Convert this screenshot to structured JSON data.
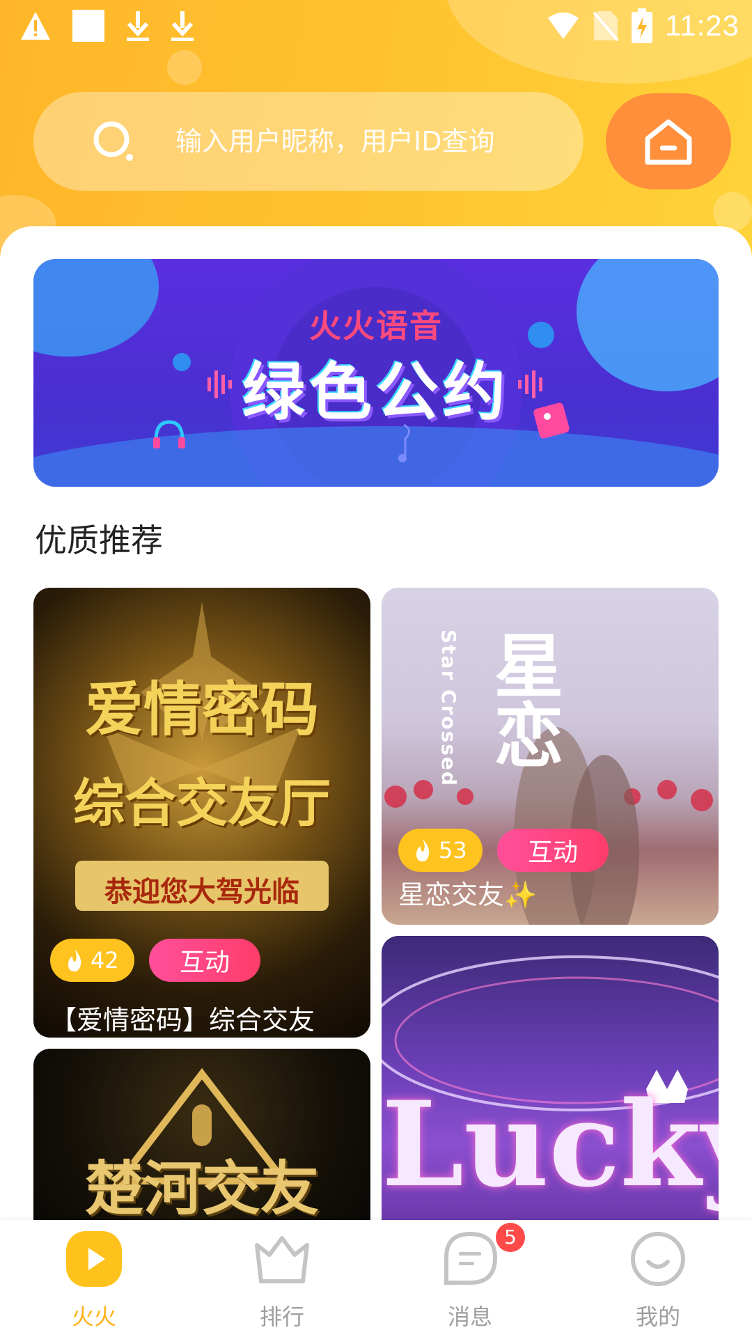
{
  "status_bar": {
    "time": "11:23"
  },
  "search": {
    "placeholder": "输入用户昵称，用户ID查询"
  },
  "banner": {
    "title_small": "火火语音",
    "title_big": "绿色公约"
  },
  "section": {
    "title": "优质推荐"
  },
  "rooms": [
    {
      "art_line1": "爱情密码",
      "art_line2": "综合交友厅",
      "art_line3": "恭迎您大驾光临",
      "heat": "42",
      "tag": "互动",
      "name": "【爱情密码】综合交友"
    },
    {
      "art_line1": "星恋",
      "art_subtitle": "Star Crossed",
      "heat": "53",
      "tag": "互动",
      "name": "星恋交友✨"
    },
    {
      "art_line1": "楚河交友"
    },
    {
      "art_line1": "Lucky"
    }
  ],
  "nav": {
    "items": [
      {
        "label": "火火",
        "icon": "play-icon"
      },
      {
        "label": "排行",
        "icon": "crown-icon"
      },
      {
        "label": "消息",
        "icon": "message-icon"
      },
      {
        "label": "我的",
        "icon": "smile-icon"
      }
    ],
    "message_badge": "5"
  },
  "colors": {
    "accent": "#ffb21c",
    "tag_pink": "#ff3d6b",
    "heat_yellow": "#ffc31f",
    "home_orange": "#ff8f3b"
  }
}
